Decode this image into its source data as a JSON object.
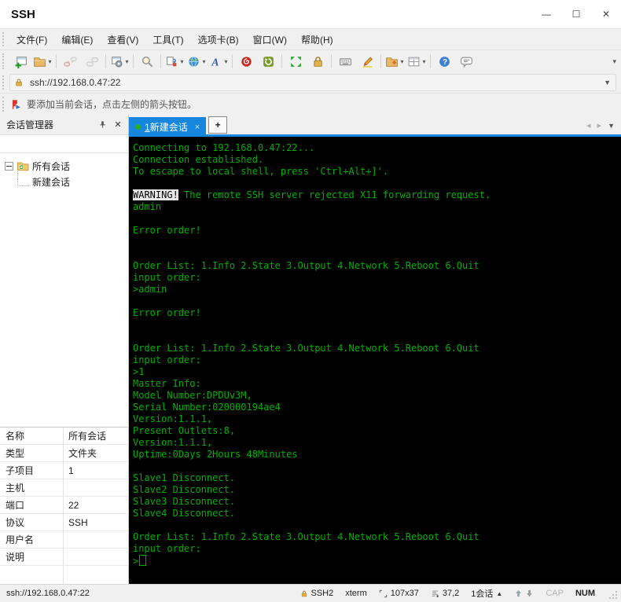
{
  "window": {
    "title": "SSH",
    "minimize": "—",
    "maximize": "☐",
    "close": "✕"
  },
  "menu": {
    "items": [
      "文件(F)",
      "编辑(E)",
      "查看(V)",
      "工具(T)",
      "选项卡(B)",
      "窗口(W)",
      "帮助(H)"
    ]
  },
  "toolbar": {
    "buttons": [
      {
        "name": "new-session-icon"
      },
      {
        "name": "open-folder-icon",
        "dropdown": true
      },
      {
        "separator": true
      },
      {
        "name": "disconnect-icon",
        "disabled": true
      },
      {
        "name": "reconnect-icon",
        "disabled": true
      },
      {
        "separator": true
      },
      {
        "name": "session-properties-icon",
        "dropdown": true
      },
      {
        "separator": true
      },
      {
        "name": "find-icon"
      },
      {
        "separator": true
      },
      {
        "name": "new-terminal-icon",
        "dropdown": true
      },
      {
        "name": "web-browser-icon",
        "dropdown": true
      },
      {
        "name": "font-icon",
        "dropdown": true
      },
      {
        "separator": true
      },
      {
        "name": "xagent-icon"
      },
      {
        "name": "refresh-icon"
      },
      {
        "separator": true
      },
      {
        "name": "fullscreen-icon"
      },
      {
        "name": "lock-icon"
      },
      {
        "separator": true
      },
      {
        "name": "virtual-keyboard-icon"
      },
      {
        "name": "highlight-pen-icon"
      },
      {
        "separator": true
      },
      {
        "name": "new-file-icon",
        "dropdown": true
      },
      {
        "name": "layout-icon",
        "dropdown": true
      },
      {
        "separator": true
      },
      {
        "name": "help-icon"
      },
      {
        "name": "feedback-icon"
      }
    ]
  },
  "address_bar": {
    "value": "ssh://192.168.0.47:22"
  },
  "note_bar": {
    "text": "要添加当前会话，点击左侧的箭头按钮。"
  },
  "session_manager": {
    "title": "会话管理器",
    "tree": {
      "root": "所有会话",
      "children": [
        "新建会话"
      ]
    }
  },
  "properties": {
    "rows": [
      {
        "label": "名称",
        "value": "所有会话"
      },
      {
        "label": "类型",
        "value": "文件夹"
      },
      {
        "label": "子项目",
        "value": "1"
      },
      {
        "label": "主机",
        "value": ""
      },
      {
        "label": "端口",
        "value": "22"
      },
      {
        "label": "协议",
        "value": "SSH"
      },
      {
        "label": "用户名",
        "value": ""
      },
      {
        "label": "说明",
        "value": ""
      }
    ]
  },
  "tab_bar": {
    "active_tab": {
      "index": "1",
      "label": "新建会话",
      "close": "×"
    },
    "new_tab": "+"
  },
  "terminal": {
    "lines": [
      "Connecting to 192.168.0.47:22...",
      "Connection established.",
      "To escape to local shell, press 'Ctrl+Alt+]'.",
      "",
      {
        "segments": [
          {
            "text": "WARNING!",
            "inverse": true
          },
          {
            "text": " The remote SSH server rejected X11 forwarding request."
          }
        ]
      },
      "admin",
      "",
      "Error order!",
      "",
      "",
      "Order List: 1.Info 2.State 3.Output 4.Network 5.Reboot 6.Quit",
      "input order:",
      ">admin",
      "",
      "Error order!",
      "",
      "",
      "Order List: 1.Info 2.State 3.Output 4.Network 5.Reboot 6.Quit",
      "input order:",
      ">1",
      "Master Info:",
      "Model Number:DPDUv3M,",
      "Serial Number:020000194ae4",
      "Version:1.1.1,",
      "Present Outlets:8,",
      "Version:1.1.1,",
      "Uptime:0Days 2Hours 48Minutes",
      "",
      "Slave1 Disconnect.",
      "Slave2 Disconnect.",
      "Slave3 Disconnect.",
      "Slave4 Disconnect.",
      "",
      "Order List: 1.Info 2.State 3.Output 4.Network 5.Reboot 6.Quit",
      "input order:",
      {
        "segments": [
          {
            "text": ">"
          }
        ],
        "cursor": true
      }
    ]
  },
  "status_bar": {
    "left": "ssh://192.168.0.47:22",
    "protocol": "SSH2",
    "terminal_type": "xterm",
    "size": "107x37",
    "cursor_pos": "37,2",
    "session_count": "1会话",
    "cap": "CAP",
    "num": "NUM"
  },
  "icons": {
    "title_controls": [
      "minimize-icon",
      "maximize-icon",
      "close-icon"
    ],
    "address": "lock-icon",
    "note": "flag-icon",
    "session_manager": [
      "pin-icon",
      "close-icon",
      "search-icon",
      "tree-expander-icon",
      "folder-sync-icon"
    ],
    "tab_bar": [
      "session-status-dot",
      "close-icon",
      "scroll-left-icon",
      "scroll-right-icon",
      "tab-list-caret-icon"
    ],
    "status": [
      "lock-icon",
      "terminal-size-icon",
      "cursor-position-icon",
      "session-list-caret-icon",
      "scroll-up-icon",
      "scroll-down-icon",
      "resize-grip-icon"
    ]
  },
  "colors": {
    "tab_active": "#1787dd",
    "terminal_bg": "#000000",
    "terminal_text": "#00b000"
  }
}
